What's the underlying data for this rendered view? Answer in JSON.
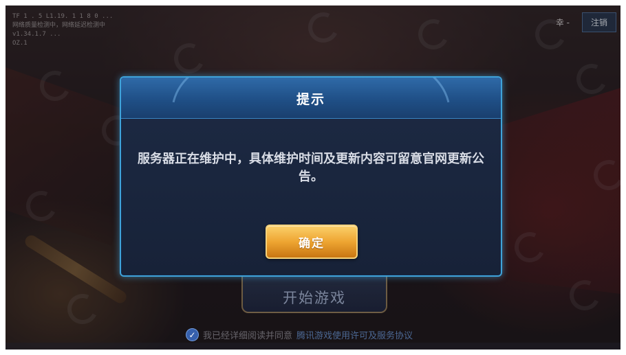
{
  "debug_lines": [
    "TF 1 . 5 L1.19. 1 1 8 0 ...",
    "网络质量检测中，网络延迟检测中",
    "v1.34.1.7 ...",
    "OZ.1"
  ],
  "top_right": {
    "user_label": "幸 -",
    "logout_label": "注销"
  },
  "dialog": {
    "title": "提示",
    "message": "服务器正在维护中，具体维护时间及更新内容可留意官网更新公告。",
    "ok_label": "确定"
  },
  "start_button": {
    "label": "开始游戏"
  },
  "agreement": {
    "prefix": "我已经详细阅读并同意",
    "link": "腾讯游戏使用许可及服务协议"
  },
  "colors": {
    "dialog_border": "#3fa3da",
    "ok_button": "#eea532",
    "dialog_bg": "#1d2a44"
  }
}
